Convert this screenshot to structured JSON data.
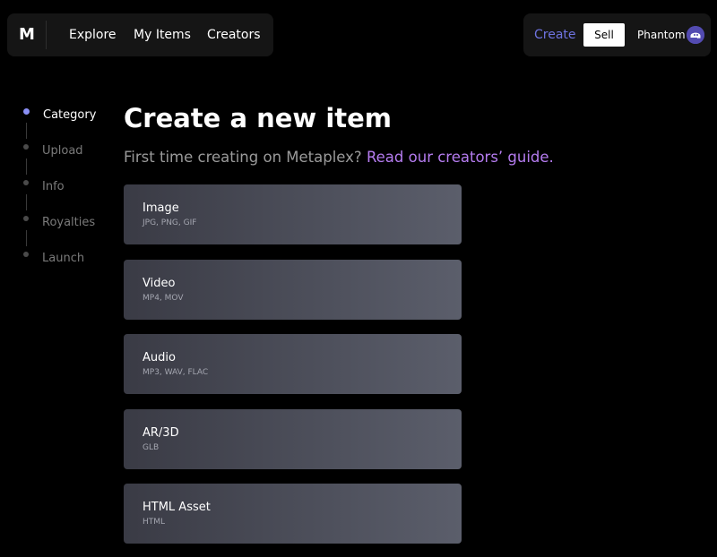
{
  "nav": {
    "logo": "M",
    "links": [
      "Explore",
      "My Items",
      "Creators"
    ],
    "create_label": "Create",
    "sell_label": "Sell",
    "wallet_name": "Phantom",
    "accent_color": "#6e73e0"
  },
  "steps": [
    {
      "label": "Category",
      "active": true
    },
    {
      "label": "Upload",
      "active": false
    },
    {
      "label": "Info",
      "active": false
    },
    {
      "label": "Royalties",
      "active": false
    },
    {
      "label": "Launch",
      "active": false
    }
  ],
  "main": {
    "title": "Create a new item",
    "subtitle_prefix": "First time creating on Metaplex? ",
    "guide_link": "Read our creators’ guide.",
    "link_color": "#b57cf0"
  },
  "categories": [
    {
      "title": "Image",
      "formats": "JPG, PNG, GIF"
    },
    {
      "title": "Video",
      "formats": "MP4, MOV"
    },
    {
      "title": "Audio",
      "formats": "MP3, WAV, FLAC"
    },
    {
      "title": "AR/3D",
      "formats": "GLB"
    },
    {
      "title": "HTML Asset",
      "formats": "HTML"
    }
  ]
}
